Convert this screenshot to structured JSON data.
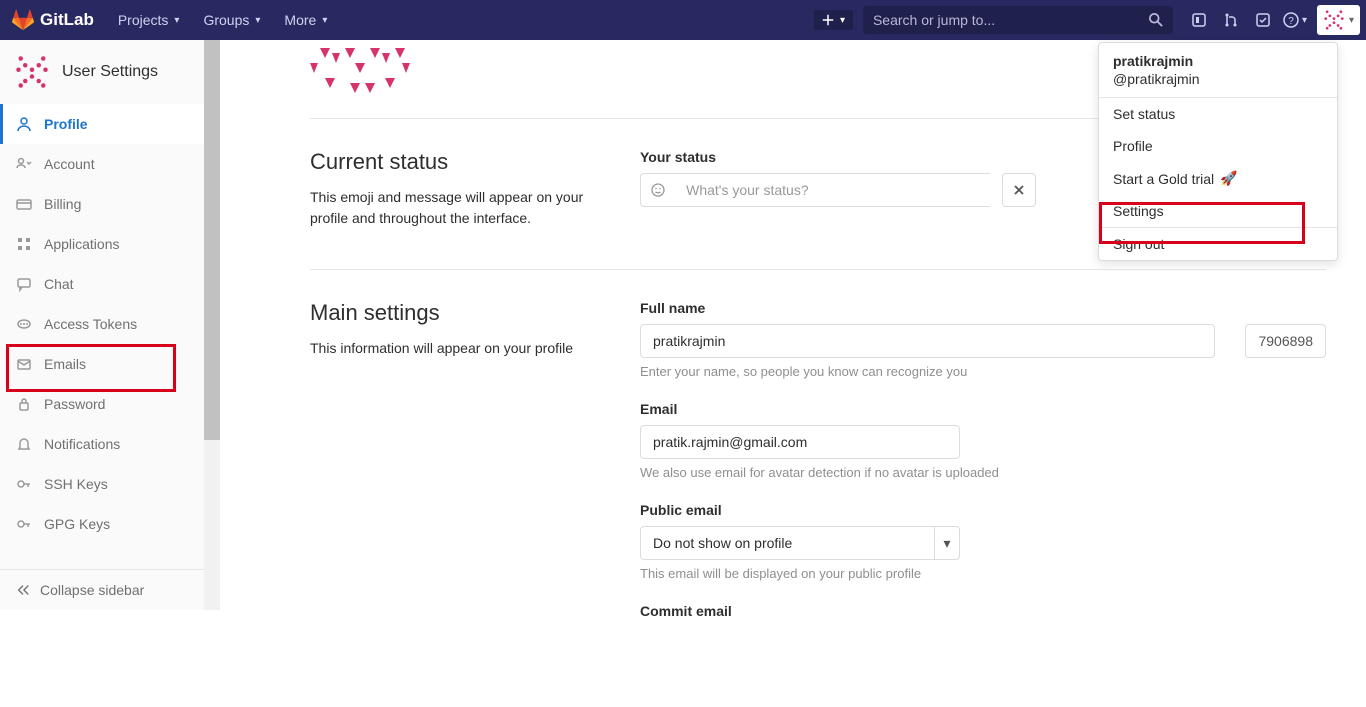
{
  "nav": {
    "brand": "GitLab",
    "projects": "Projects",
    "groups": "Groups",
    "more": "More",
    "search_placeholder": "Search or jump to..."
  },
  "sidebar": {
    "title": "User Settings",
    "items": [
      {
        "label": "Profile"
      },
      {
        "label": "Account"
      },
      {
        "label": "Billing"
      },
      {
        "label": "Applications"
      },
      {
        "label": "Chat"
      },
      {
        "label": "Access Tokens"
      },
      {
        "label": "Emails"
      },
      {
        "label": "Password"
      },
      {
        "label": "Notifications"
      },
      {
        "label": "SSH Keys"
      },
      {
        "label": "GPG Keys"
      }
    ],
    "collapse": "Collapse sidebar"
  },
  "status": {
    "heading": "Current status",
    "desc": "This emoji and message will appear on your profile and throughout the interface.",
    "label": "Your status",
    "placeholder": "What's your status?"
  },
  "main": {
    "heading": "Main settings",
    "desc": "This information will appear on your profile",
    "fullname_label": "Full name",
    "fullname_value": "pratikrajmin",
    "fullname_help": "Enter your name, so people you know can recognize you",
    "userid_value": "7906898",
    "email_label": "Email",
    "email_value": "pratik.rajmin@gmail.com",
    "email_help": "We also use email for avatar detection if no avatar is uploaded",
    "public_email_label": "Public email",
    "public_email_value": "Do not show on profile",
    "public_email_help": "This email will be displayed on your public profile",
    "commit_email_label": "Commit email"
  },
  "dropdown": {
    "name": "pratikrajmin",
    "handle": "@pratikrajmin",
    "set_status": "Set status",
    "profile": "Profile",
    "gold_trial": "Start a Gold trial",
    "settings": "Settings",
    "sign_out": "Sign out"
  }
}
